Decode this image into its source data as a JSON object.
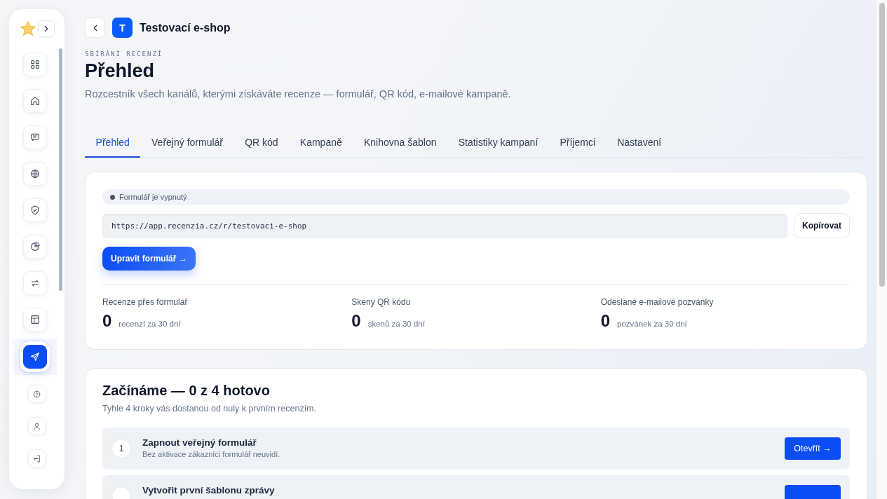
{
  "sidebar": {
    "nav_items": [
      {
        "kind": "grid",
        "selected": false
      },
      {
        "kind": "home",
        "selected": false
      },
      {
        "kind": "chat",
        "selected": false
      },
      {
        "kind": "globe",
        "selected": false
      },
      {
        "kind": "shield",
        "selected": false
      },
      {
        "kind": "pie",
        "selected": false
      },
      {
        "kind": "swap",
        "selected": false
      },
      {
        "kind": "layout",
        "selected": false
      },
      {
        "kind": "send",
        "selected": true
      }
    ],
    "bottom_items": [
      {
        "kind": "help"
      },
      {
        "kind": "user"
      },
      {
        "kind": "logout"
      }
    ]
  },
  "header": {
    "shop_initial": "T",
    "shop_name": "Testovací e-shop"
  },
  "eyebrow": "SBÍRÁNÍ RECENZÍ",
  "title": "Přehled",
  "subtitle": "Rozcestník všech kanálů, kterými získáváte recenze — formulář, QR kód, e-mailové kampaně.",
  "tabs": [
    {
      "label": "Přehled",
      "selected": true
    },
    {
      "label": "Veřejný formulář",
      "selected": false
    },
    {
      "label": "QR kód",
      "selected": false
    },
    {
      "label": "Kampaně",
      "selected": false
    },
    {
      "label": "Knihovna šablon",
      "selected": false
    },
    {
      "label": "Statistiky kampaní",
      "selected": false
    },
    {
      "label": "Příjemci",
      "selected": false
    },
    {
      "label": "Nastavení",
      "selected": false
    }
  ],
  "form_card": {
    "status": {
      "label": "Formulář je vypnutý",
      "on": false
    },
    "url": "https://app.recenzia.cz/r/testovaci-e-shop",
    "copy_button": "Kopírovat",
    "edit_button": "Upravit formulář →",
    "stats": [
      {
        "label": "Recenze přes formulář",
        "value": "0",
        "unit": "recenzí za 30 dní"
      },
      {
        "label": "Skeny QR kódu",
        "value": "0",
        "unit": "skenů za 30 dní"
      },
      {
        "label": "Odeslané e-mailové pozvánky",
        "value": "0",
        "unit": "pozvánek za 30 dní"
      }
    ]
  },
  "onboarding": {
    "title": "Začínáme — 0 z 4 hotovo",
    "description": "Tyhle 4 kroky vás dostanou od nuly k prvním recenzím.",
    "steps": [
      {
        "number": "1",
        "title": "Zapnout veřejný formulář",
        "description": "Bez aktivace zákazníci formulář neuvidí.",
        "action": "Otevřít →"
      },
      {
        "title": "Vytvořit první šablonu zprávy"
      }
    ]
  }
}
